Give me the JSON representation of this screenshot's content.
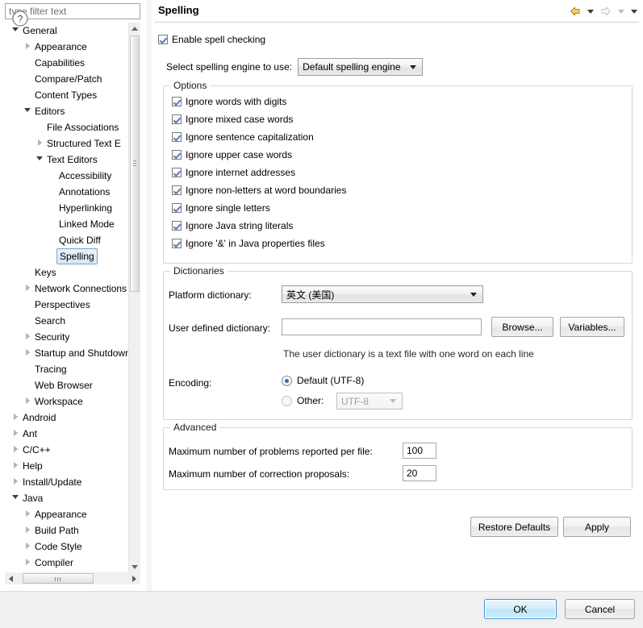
{
  "filter": {
    "placeholder": "type filter text",
    "value": ""
  },
  "tree": {
    "items": [
      {
        "label": "General",
        "depth": 0,
        "twisty": "expanded"
      },
      {
        "label": "Appearance",
        "depth": 1,
        "twisty": "collapsed"
      },
      {
        "label": "Capabilities",
        "depth": 1,
        "twisty": "none"
      },
      {
        "label": "Compare/Patch",
        "depth": 1,
        "twisty": "none"
      },
      {
        "label": "Content Types",
        "depth": 1,
        "twisty": "none"
      },
      {
        "label": "Editors",
        "depth": 1,
        "twisty": "expanded"
      },
      {
        "label": "File Associations",
        "depth": 2,
        "twisty": "none"
      },
      {
        "label": "Structured Text E",
        "depth": 2,
        "twisty": "collapsed"
      },
      {
        "label": "Text Editors",
        "depth": 2,
        "twisty": "expanded"
      },
      {
        "label": "Accessibility",
        "depth": 3,
        "twisty": "none"
      },
      {
        "label": "Annotations",
        "depth": 3,
        "twisty": "none"
      },
      {
        "label": "Hyperlinking",
        "depth": 3,
        "twisty": "none"
      },
      {
        "label": "Linked Mode",
        "depth": 3,
        "twisty": "none"
      },
      {
        "label": "Quick Diff",
        "depth": 3,
        "twisty": "none"
      },
      {
        "label": "Spelling",
        "depth": 3,
        "twisty": "none",
        "selected": true
      },
      {
        "label": "Keys",
        "depth": 1,
        "twisty": "none"
      },
      {
        "label": "Network Connections",
        "depth": 1,
        "twisty": "collapsed"
      },
      {
        "label": "Perspectives",
        "depth": 1,
        "twisty": "none"
      },
      {
        "label": "Search",
        "depth": 1,
        "twisty": "none"
      },
      {
        "label": "Security",
        "depth": 1,
        "twisty": "collapsed"
      },
      {
        "label": "Startup and Shutdown",
        "depth": 1,
        "twisty": "collapsed"
      },
      {
        "label": "Tracing",
        "depth": 1,
        "twisty": "none"
      },
      {
        "label": "Web Browser",
        "depth": 1,
        "twisty": "none"
      },
      {
        "label": "Workspace",
        "depth": 1,
        "twisty": "collapsed"
      },
      {
        "label": "Android",
        "depth": 0,
        "twisty": "collapsed"
      },
      {
        "label": "Ant",
        "depth": 0,
        "twisty": "collapsed"
      },
      {
        "label": "C/C++",
        "depth": 0,
        "twisty": "collapsed"
      },
      {
        "label": "Help",
        "depth": 0,
        "twisty": "collapsed"
      },
      {
        "label": "Install/Update",
        "depth": 0,
        "twisty": "collapsed"
      },
      {
        "label": "Java",
        "depth": 0,
        "twisty": "expanded"
      },
      {
        "label": "Appearance",
        "depth": 1,
        "twisty": "collapsed"
      },
      {
        "label": "Build Path",
        "depth": 1,
        "twisty": "collapsed"
      },
      {
        "label": "Code Style",
        "depth": 1,
        "twisty": "collapsed"
      },
      {
        "label": "Compiler",
        "depth": 1,
        "twisty": "collapsed"
      }
    ]
  },
  "page": {
    "title": "Spelling",
    "nav": {
      "back_icon": "back-arrow-icon",
      "back_menu_icon": "chevron-down-icon",
      "forward_icon": "forward-arrow-icon",
      "forward_menu_icon": "chevron-down-icon",
      "view_menu_icon": "chevron-down-icon"
    },
    "enable_spell_checking": {
      "label": "Enable spell checking",
      "checked": true
    },
    "engine": {
      "label": "Select spelling engine to use:",
      "value": "Default spelling engine"
    },
    "options": {
      "title": "Options",
      "items": [
        {
          "label": "Ignore words with digits",
          "checked": true
        },
        {
          "label": "Ignore mixed case words",
          "checked": true
        },
        {
          "label": "Ignore sentence capitalization",
          "checked": true
        },
        {
          "label": "Ignore upper case words",
          "checked": true
        },
        {
          "label": "Ignore internet addresses",
          "checked": true
        },
        {
          "label": "Ignore non-letters at word boundaries",
          "checked": true
        },
        {
          "label": "Ignore single letters",
          "checked": true
        },
        {
          "label": "Ignore Java string literals",
          "checked": true
        },
        {
          "label": "Ignore '&' in Java properties files",
          "checked": true
        }
      ]
    },
    "dictionaries": {
      "title": "Dictionaries",
      "platform_label": "Platform dictionary:",
      "platform_value": "英文 (美国)",
      "user_label": "User defined dictionary:",
      "user_value": "",
      "browse_label": "Browse...",
      "variables_label": "Variables...",
      "hint": "The user dictionary is a text file with one word on each line",
      "encoding_label": "Encoding:",
      "encoding_default_label": "Default (UTF-8)",
      "encoding_default_selected": true,
      "encoding_other_label": "Other:",
      "encoding_other_selected": false,
      "encoding_other_value": "UTF-8"
    },
    "advanced": {
      "title": "Advanced",
      "max_problems_label": "Maximum number of problems reported per file:",
      "max_problems_value": "100",
      "max_proposals_label": "Maximum number of correction proposals:",
      "max_proposals_value": "20"
    },
    "restore_defaults_label": "Restore Defaults",
    "apply_label": "Apply"
  },
  "footer": {
    "help_icon": "help-question-icon",
    "ok_label": "OK",
    "cancel_label": "Cancel"
  },
  "colors": {
    "selection_border": "#7da2ce",
    "selection_fill": "#d4e6f8",
    "ok_accent": "#3c97d3",
    "back_arrow": "#f2c14b"
  }
}
